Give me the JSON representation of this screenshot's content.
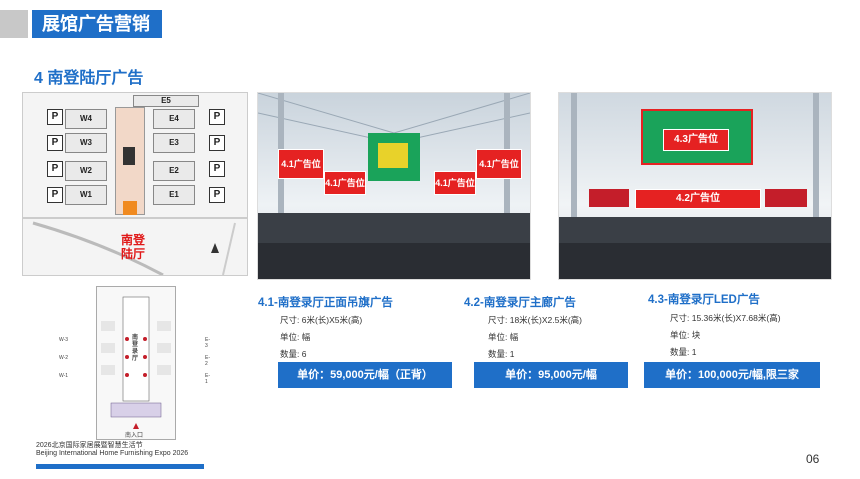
{
  "header": {
    "title": "展馆广告营销"
  },
  "section": {
    "title": "4 南登陆厅广告"
  },
  "map": {
    "top_hall": "E5",
    "west_halls": [
      "W4",
      "W3",
      "W2",
      "W1"
    ],
    "east_halls": [
      "E4",
      "E3",
      "E2",
      "E1"
    ],
    "parking_symbol": "P",
    "label_line1": "南登",
    "label_line2": "陆厅"
  },
  "photo1": {
    "tags": [
      "4.1广告位",
      "4.1广告位",
      "4.1广告位",
      "4.1广告位"
    ]
  },
  "photo2": {
    "tags": [
      "4.3广告位",
      "4.2广告位"
    ]
  },
  "floorplan": {
    "center": "南登录厅",
    "west": [
      "W-3",
      "W-2",
      "W-1"
    ],
    "east": [
      "E-3",
      "E-2",
      "E-1"
    ],
    "entrance": "南入口"
  },
  "ads": [
    {
      "title": "4.1-南登录厅正面吊旗广告",
      "size": "尺寸: 6米(长)X5米(高)",
      "unit": "单位: 幅",
      "qty": "数量: 6",
      "price": "单价：59,000元/幅（正背）"
    },
    {
      "title": "4.2-南登录厅主廊广告",
      "size": "尺寸: 18米(长)X2.5米(高)",
      "unit": "单位: 幅",
      "qty": "数量: 1",
      "price": "单价：95,000元/幅"
    },
    {
      "title": "4.3-南登录厅LED广告",
      "size": "尺寸: 15.36米(长)X7.68米(高)",
      "unit": "单位: 块",
      "qty": "数量: 1",
      "price": "单价：100,000元/幅,限三家"
    }
  ],
  "footer": {
    "line1": "2026北京国际家居展暨智慧生活节",
    "line2": "Beijing International Home Furnishing Expo 2026",
    "page": "06"
  },
  "colors": {
    "brand_blue": "#1f6fc8",
    "ad_red": "#e52222"
  }
}
